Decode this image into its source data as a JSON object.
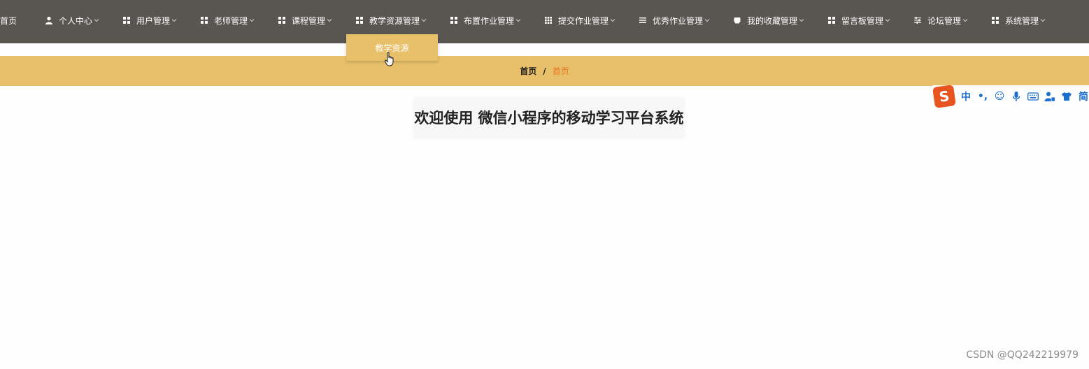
{
  "nav": {
    "items": [
      {
        "label": "首页",
        "icon": "none",
        "has_chevron": false
      },
      {
        "label": "个人中心",
        "icon": "user-icon",
        "has_chevron": true
      },
      {
        "label": "用户管理",
        "icon": "grid-icon",
        "has_chevron": true
      },
      {
        "label": "老师管理",
        "icon": "grid-icon",
        "has_chevron": true
      },
      {
        "label": "课程管理",
        "icon": "grid-icon",
        "has_chevron": true
      },
      {
        "label": "教学资源管理",
        "icon": "grid-icon",
        "has_chevron": true
      },
      {
        "label": "布置作业管理",
        "icon": "grid-icon",
        "has_chevron": true
      },
      {
        "label": "提交作业管理",
        "icon": "dots-grid-icon",
        "has_chevron": true
      },
      {
        "label": "优秀作业管理",
        "icon": "list-icon",
        "has_chevron": true
      },
      {
        "label": "我的收藏管理",
        "icon": "folder-icon",
        "has_chevron": true
      },
      {
        "label": "留言板管理",
        "icon": "grid-icon",
        "has_chevron": true
      },
      {
        "label": "论坛管理",
        "icon": "sliders-icon",
        "has_chevron": true
      },
      {
        "label": "系统管理",
        "icon": "grid-icon",
        "has_chevron": true
      }
    ],
    "dropdown": {
      "parent": "教学资源管理",
      "items": [
        "教学资源"
      ]
    }
  },
  "breadcrumb": {
    "home": "首页",
    "separator": "/",
    "current": "首页"
  },
  "main": {
    "welcome": "欢迎使用 微信小程序的移动学习平台系统"
  },
  "ime": {
    "logo": "S",
    "buttons": [
      "中",
      "•,",
      "☺",
      "🎤",
      "⌨",
      "👤",
      "👕",
      "简"
    ]
  },
  "watermark": "CSDN @QQ242219979",
  "colors": {
    "nav_bg": "#595550",
    "accent": "#e8c069",
    "current_crumb": "#e87722",
    "ime_blue": "#1a6fd0"
  }
}
